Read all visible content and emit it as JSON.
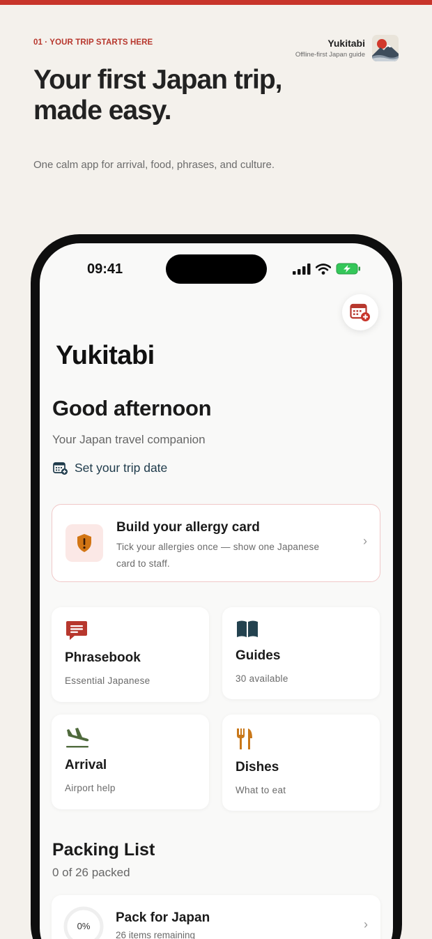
{
  "hero": {
    "eyebrow": "01 · YOUR TRIP STARTS HERE",
    "title": "Your first Japan trip, made easy.",
    "subtitle": "One calm app for arrival, food, phrases, and culture."
  },
  "brand": {
    "name": "Yukitabi",
    "tagline": "Offline-first Japan guide",
    "logo_icon": "mount-fuji-sunrise-logo"
  },
  "status_bar": {
    "time": "09:41",
    "icons": [
      "signal-icon",
      "wifi-icon",
      "battery-charging-icon"
    ]
  },
  "app": {
    "title": "Yukitabi",
    "greeting": "Good afternoon",
    "tagline": "Your Japan travel companion",
    "set_trip_date": "Set your trip date",
    "calendar_action_icon": "calendar-add-icon"
  },
  "allergy_card": {
    "title": "Build your allergy card",
    "description": "Tick your allergies once — show one Japanese card to staff.",
    "icon": "shield-alert-icon"
  },
  "tiles": [
    {
      "title": "Phrasebook",
      "subtitle": "Essential Japanese",
      "icon": "chat-bubble-icon",
      "color": "#b7372d"
    },
    {
      "title": "Guides",
      "subtitle": "30 available",
      "icon": "open-book-icon",
      "color": "#23424f"
    },
    {
      "title": "Arrival",
      "subtitle": "Airport help",
      "icon": "plane-landing-icon",
      "color": "#4f6a3c"
    },
    {
      "title": "Dishes",
      "subtitle": "What to eat",
      "icon": "fork-knife-icon",
      "color": "#c9781a"
    }
  ],
  "packing": {
    "section_title": "Packing List",
    "count": "0 of 26 packed",
    "card_title": "Pack for Japan",
    "card_sub": "26 items remaining",
    "progress_label": "0%",
    "progress": 0
  },
  "colors": {
    "accent_red": "#c8352b",
    "background": "#f4f1ec",
    "link_navy": "#1e3a4a",
    "battery_green": "#34c759"
  }
}
